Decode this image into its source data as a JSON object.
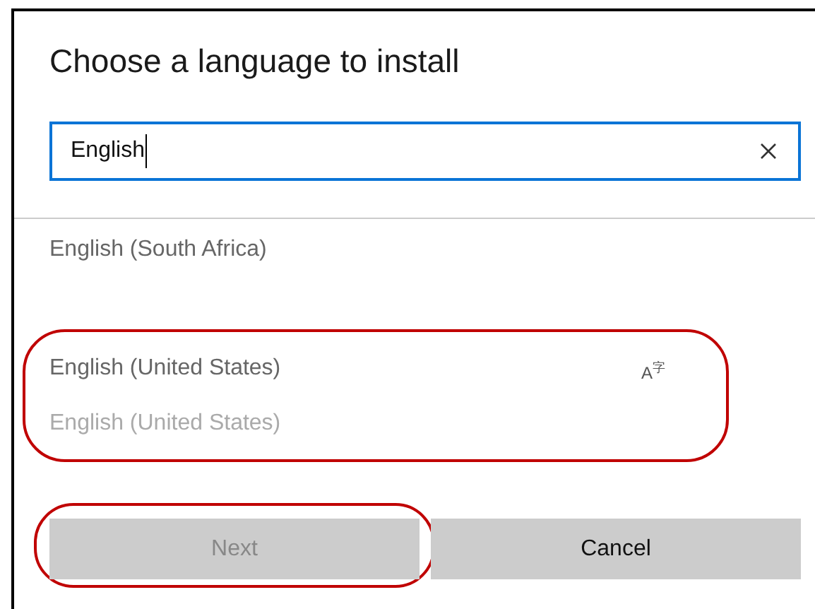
{
  "dialog": {
    "title": "Choose a language to install",
    "search": {
      "value": "English",
      "focused": true
    },
    "languages": [
      {
        "name": "English (South Africa)",
        "highlighted": false
      },
      {
        "name": "English (United States)",
        "subtitle": "English (United States)",
        "icon": "A$^{字}$",
        "highlighted": true
      }
    ],
    "buttons": [
      {
        "label": "Next",
        "disabled": true,
        "highlighted": true
      },
      {
        "label": "Cancel",
        "disabled": false,
        "highlighted": false
      }
    ]
  }
}
